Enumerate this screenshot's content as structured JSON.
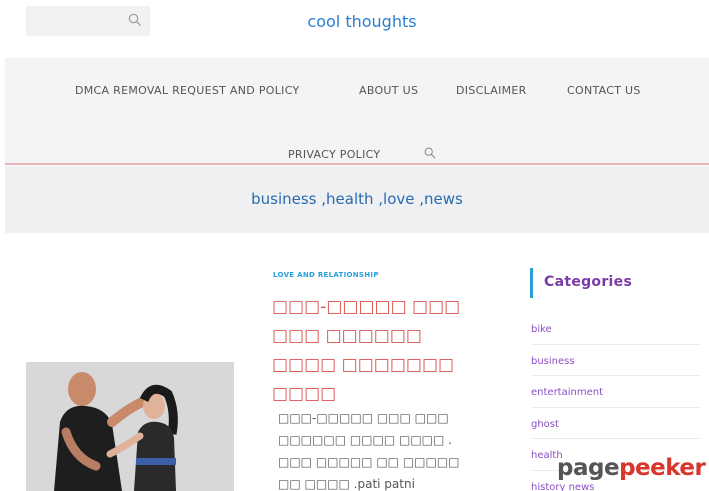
{
  "site": {
    "title": "cool thoughts",
    "tagline": "business ,health ,love ,news"
  },
  "nav": {
    "items": [
      {
        "label": "DMCA REMOVAL REQUEST AND POLICY"
      },
      {
        "label": "ABOUT US"
      },
      {
        "label": "DISCLAIMER"
      },
      {
        "label": "CONTACT US"
      },
      {
        "label": "PRIVACY POLICY"
      }
    ]
  },
  "post": {
    "category": "LOVE AND RELATIONSHIP",
    "title": "□□□-□□□□□ □□□ □□□ □□□□□□ □□□□ □□□□□□□ □□□□",
    "excerpt": "□□□-□□□□□ □□□ □□□ □□□□□□ □□□□ □□□□ . □□□ □□□□□ □□ □□□□□ □□ □□□□ .pati patni"
  },
  "sidebar": {
    "heading": "Categories",
    "categories": [
      {
        "label": "bike"
      },
      {
        "label": "business"
      },
      {
        "label": "entertainment"
      },
      {
        "label": "ghost"
      },
      {
        "label": "health"
      },
      {
        "label": "history news"
      }
    ]
  },
  "watermark": {
    "part1": "page",
    "part2": "peeker"
  },
  "colors": {
    "title_blue": "#2a7fd4",
    "post_title_red": "#d9534f",
    "category_purple": "#8b4fc4",
    "accent_blue": "#2a9fd8"
  },
  "icons": {
    "header_search": "search-icon",
    "nav_search": "search-icon"
  }
}
